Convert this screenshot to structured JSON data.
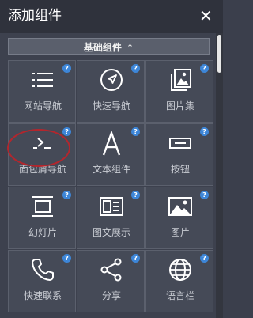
{
  "header": {
    "title": "添加组件",
    "close_label": "✕"
  },
  "section": {
    "label": "基础组件",
    "chevron": "⌃"
  },
  "help_label": "?",
  "tiles": [
    {
      "label": "网站导航",
      "icon": "list-icon"
    },
    {
      "label": "快速导航",
      "icon": "navigation-arrow-icon"
    },
    {
      "label": "图片集",
      "icon": "image-gallery-icon"
    },
    {
      "label": "面包屑导航",
      "icon": "terminal-prompt-icon"
    },
    {
      "label": "文本组件",
      "icon": "text-a-icon"
    },
    {
      "label": "按钮",
      "icon": "button-icon"
    },
    {
      "label": "幻灯片",
      "icon": "slideshow-icon"
    },
    {
      "label": "图文展示",
      "icon": "image-text-icon"
    },
    {
      "label": "图片",
      "icon": "picture-icon"
    },
    {
      "label": "快速联系",
      "icon": "phone-icon"
    },
    {
      "label": "分享",
      "icon": "share-icon"
    },
    {
      "label": "语言栏",
      "icon": "globe-icon"
    }
  ]
}
